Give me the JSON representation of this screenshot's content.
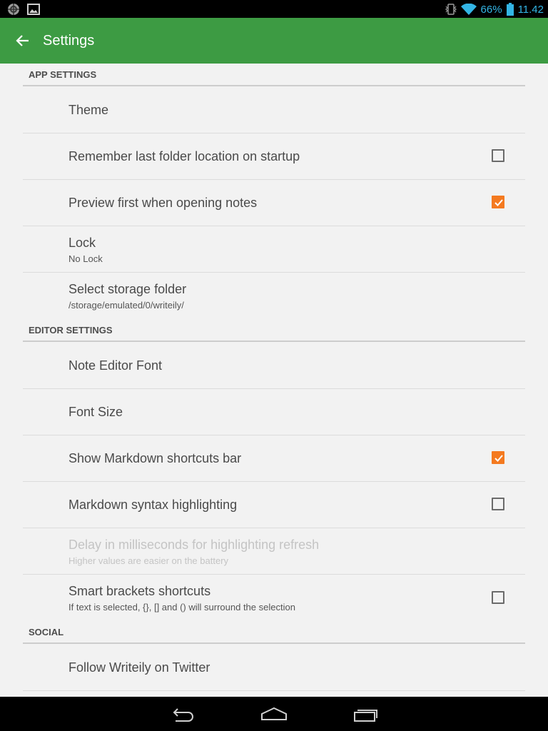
{
  "status_bar": {
    "battery": "66%",
    "time": "11.42",
    "icons": [
      "globe-icon",
      "image-icon",
      "vibrate-icon",
      "wifi-icon",
      "battery-icon"
    ]
  },
  "app_bar": {
    "title": "Settings",
    "back_icon": "arrow-left-icon"
  },
  "sections": {
    "app": {
      "header": "APP SETTINGS"
    },
    "editor": {
      "header": "EDITOR SETTINGS"
    },
    "social": {
      "header": "SOCIAL"
    }
  },
  "prefs": {
    "theme": {
      "title": "Theme"
    },
    "remember_folder": {
      "title": "Remember last folder location on startup",
      "checked": false
    },
    "preview_first": {
      "title": "Preview first when opening notes",
      "checked": true
    },
    "lock": {
      "title": "Lock",
      "summary": "No Lock"
    },
    "storage_folder": {
      "title": "Select storage folder",
      "summary": "/storage/emulated/0/writeily/"
    },
    "editor_font": {
      "title": "Note Editor Font"
    },
    "font_size": {
      "title": "Font Size"
    },
    "markdown_bar": {
      "title": "Show Markdown shortcuts bar",
      "checked": true
    },
    "syntax_highlight": {
      "title": "Markdown syntax highlighting",
      "checked": false
    },
    "highlight_delay": {
      "title": "Delay in milliseconds for highlighting refresh",
      "summary": "Higher values are easier on the battery",
      "enabled": false
    },
    "smart_brackets": {
      "title": "Smart brackets shortcuts",
      "summary": "If text is selected, {}, [] and () will surround the selection",
      "checked": false
    },
    "twitter": {
      "title": "Follow Writeily on Twitter"
    }
  },
  "colors": {
    "app_bar": "#3d9b43",
    "checkbox_checked": "#f47a20",
    "status_text": "#33b5e5"
  },
  "nav_bar": {
    "icons": [
      "back-nav-icon",
      "home-nav-icon",
      "recents-nav-icon"
    ]
  }
}
